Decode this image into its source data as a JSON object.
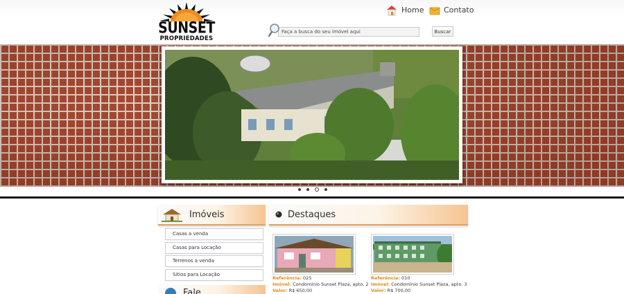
{
  "header": {
    "logo": {
      "word": "SUNSET",
      "sub": "PROPRIEDADES"
    },
    "nav": [
      {
        "label": "Home",
        "icon": "home-icon"
      },
      {
        "label": "Contato",
        "icon": "mail-icon"
      }
    ],
    "search": {
      "placeholder": "Faça a busca do seu imóvel aqui",
      "value": "",
      "button_label": "Buscar"
    }
  },
  "banner": {
    "slides": 4,
    "active_slide": 3,
    "photo": "house-photo"
  },
  "imoveis": {
    "title": "Imóveis",
    "items": [
      {
        "label": "Casas a venda"
      },
      {
        "label": "Casas para Locação"
      },
      {
        "label": "Terrenos a venda"
      },
      {
        "label": "Sitios para Locação"
      }
    ]
  },
  "second_section": {
    "title": "Fale"
  },
  "destaques": {
    "title": "Destaques",
    "cards": [
      {
        "ref_label": "Referência:",
        "ref": "025",
        "imovel_label": "Imóvel:",
        "imovel": "Condomínio Sunset Plaza, apto. 2",
        "valor_label": "Valor:",
        "valor": "R$ 650,00"
      },
      {
        "ref_label": "Referência:",
        "ref": "010",
        "imovel_label": "Imóvel:",
        "imovel": "Condomínio Sunset Plaza, apto. 3",
        "valor_label": "Valor:",
        "valor": "R$ 700,00"
      }
    ]
  },
  "colors": {
    "accent_orange": "#e08b1f",
    "brick": "#a94a32",
    "mortar": "#dcd3c7"
  }
}
